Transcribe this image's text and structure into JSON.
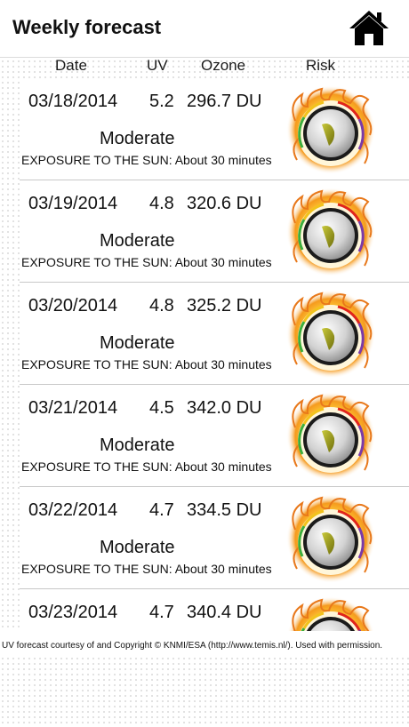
{
  "header": {
    "title": "Weekly forecast",
    "home_icon": "home-icon"
  },
  "columns": {
    "date": "Date",
    "uv": "UV",
    "ozone": "Ozone",
    "risk": "Risk"
  },
  "rows": [
    {
      "date": "03/18/2014",
      "uv": "5.2",
      "ozone": "296.7 DU",
      "risk": "Moderate",
      "exposure": "EXPOSURE TO THE SUN: About 30 minutes"
    },
    {
      "date": "03/19/2014",
      "uv": "4.8",
      "ozone": "320.6 DU",
      "risk": "Moderate",
      "exposure": "EXPOSURE TO THE SUN: About 30 minutes"
    },
    {
      "date": "03/20/2014",
      "uv": "4.8",
      "ozone": "325.2 DU",
      "risk": "Moderate",
      "exposure": "EXPOSURE TO THE SUN: About 30 minutes"
    },
    {
      "date": "03/21/2014",
      "uv": "4.5",
      "ozone": "342.0 DU",
      "risk": "Moderate",
      "exposure": "EXPOSURE TO THE SUN: About 30 minutes"
    },
    {
      "date": "03/22/2014",
      "uv": "4.7",
      "ozone": "334.5 DU",
      "risk": "Moderate",
      "exposure": "EXPOSURE TO THE SUN: About 30 minutes"
    },
    {
      "date": "03/23/2014",
      "uv": "4.7",
      "ozone": "340.4 DU",
      "risk": "",
      "exposure": ""
    }
  ],
  "gauge_icon": "uv-risk-gauge-icon",
  "footer": {
    "text": "UV forecast courtesy of and Copyright © KNMI/ESA (http://www.temis.nl/). Used with permission."
  },
  "colors": {
    "flame_orange": "#f59a1e",
    "needle_olive": "#8a8a14",
    "divider": "#c8c8c8"
  }
}
